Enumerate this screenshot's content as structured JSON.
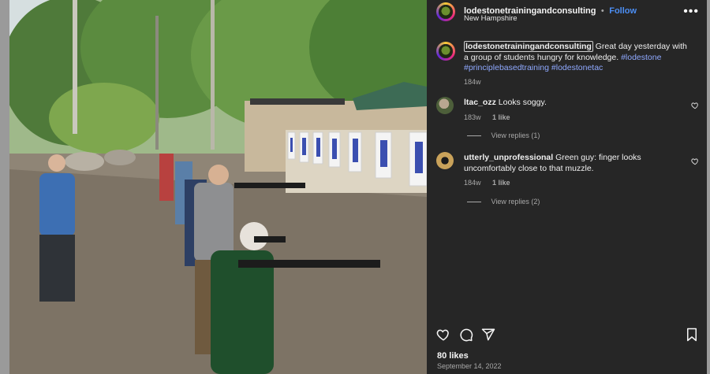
{
  "post": {
    "username": "lodestonetrainingandconsulting",
    "separator": "•",
    "follow_label": "Follow",
    "location": "New Hampshire",
    "more_label": "•••"
  },
  "caption": {
    "mention": "lodestonetrainingandconsulting",
    "text": "Great day yesterday with a group of students hungry for knowledge.",
    "hashtags": [
      "#lodestone",
      "#principlebasedtraining",
      "#lodestonetac"
    ],
    "time": "184w"
  },
  "comments": [
    {
      "username": "ltac_ozz",
      "text": "Looks soggy.",
      "time": "183w",
      "likes": "1 like",
      "replies": "View replies (1)"
    },
    {
      "username": "utterly_unprofessional",
      "text": "Green guy: finger looks uncomfortably close to that muzzle.",
      "time": "184w",
      "likes": "1 like",
      "replies": "View replies (2)"
    }
  ],
  "actions": {
    "like_icon": "heart-icon",
    "comment_icon": "comment-icon",
    "share_icon": "share-icon",
    "save_icon": "bookmark-icon"
  },
  "stats": {
    "likes": "80 likes",
    "date": "September 14, 2022"
  },
  "colors": {
    "panel_bg": "#262626",
    "link": "#4c8ff5",
    "hashtag": "#8fa9ff",
    "muted": "#a8a8a8"
  }
}
